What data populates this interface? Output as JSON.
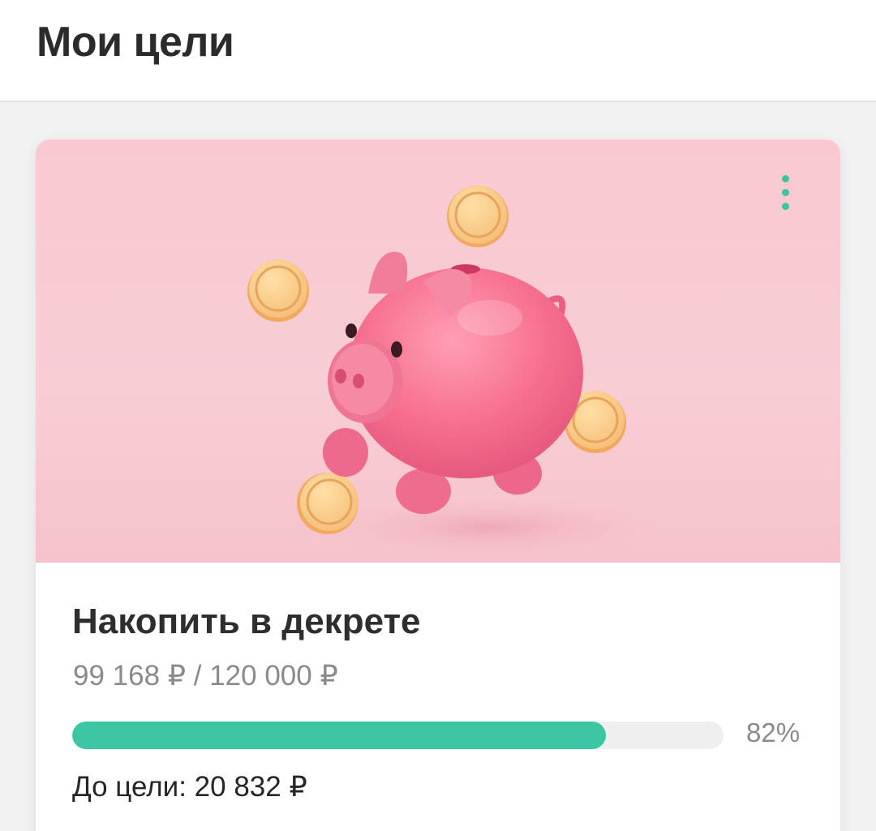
{
  "header": {
    "title": "Мои цели"
  },
  "goal": {
    "title": "Накопить в декрете",
    "amounts": "99 168 ₽ / 120 000 ₽",
    "progress_percent": 82,
    "progress_label": "82%",
    "remaining_label": "До цели: 20 832 ₽",
    "menu_icon": "more-vertical-icon",
    "accent_color": "#3cc6a4"
  }
}
